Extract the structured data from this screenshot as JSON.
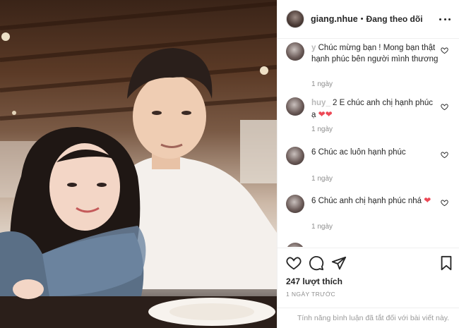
{
  "header": {
    "username": "giang.nhue",
    "separator": "•",
    "follow_status": "Đang theo dõi"
  },
  "comments": [
    {
      "user": "y",
      "text": "Chúc mừng bạn ! Mong bạn thật hạnh phúc bên người mình thương",
      "time": "1 ngày"
    },
    {
      "user": "huy_",
      "text": "2 E chúc anh chị hạnh phúc ạ",
      "hearts": "❤❤",
      "time": "1 ngày"
    },
    {
      "user": "",
      "text": "6 Chúc ac luôn hạnh phúc",
      "time": "1 ngày"
    },
    {
      "user": "",
      "text": "6 Chúc anh chị hạnh phúc nhá",
      "hearts": "❤",
      "time": "1 ngày"
    }
  ],
  "actions": {
    "likes": "247 lượt thích",
    "date": "1 NGÀY TRƯỚC",
    "comments_disabled": "Tính năng bình luận đã tắt đối với bài viết này."
  },
  "icons": [
    "like-icon",
    "comment-icon",
    "share-icon",
    "save-icon",
    "more-icon"
  ]
}
